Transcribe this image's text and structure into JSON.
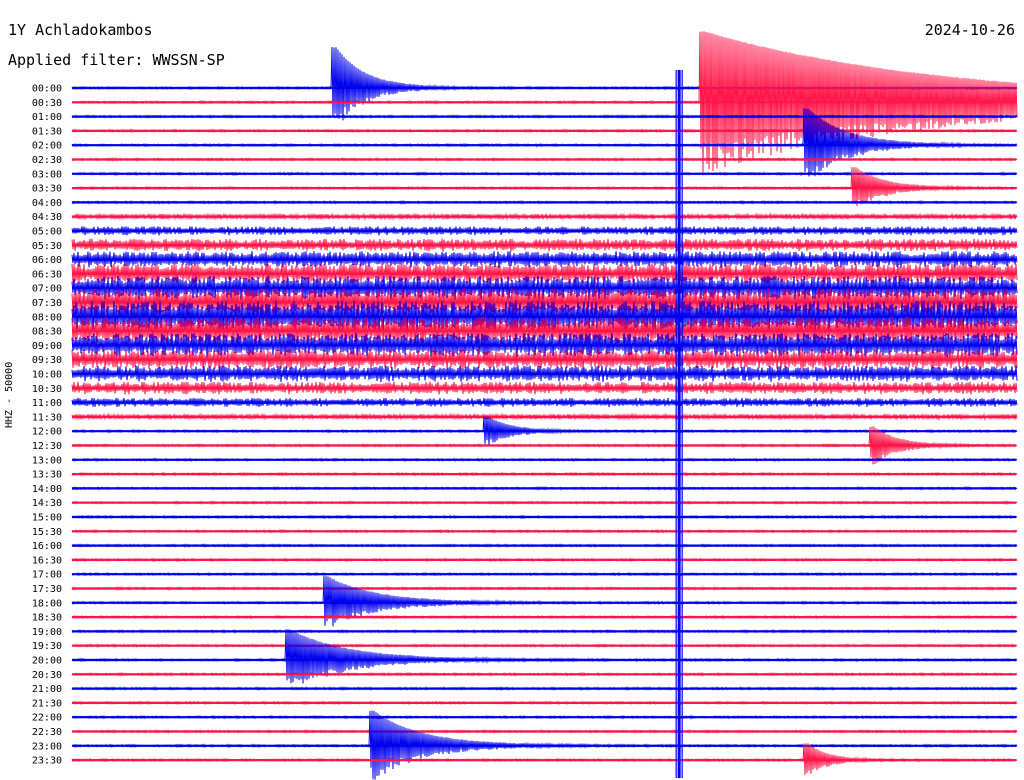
{
  "header": {
    "station": "1Y Achladokambos",
    "date": "2024-10-26",
    "filter": "Applied filter: WWSSN-SP"
  },
  "ylabel": "HHZ - 50000",
  "chart_data": {
    "type": "line",
    "title": "1Y Achladokambos",
    "subtitle": "Applied filter: WWSSN-SP",
    "ylabel": "HHZ - 50000",
    "date": "2024-10-26",
    "time_labels": [
      "00:00",
      "00:30",
      "01:00",
      "01:30",
      "02:00",
      "02:30",
      "03:00",
      "03:30",
      "04:00",
      "04:30",
      "05:00",
      "05:30",
      "06:00",
      "06:30",
      "07:00",
      "07:30",
      "08:00",
      "08:30",
      "09:00",
      "09:30",
      "10:00",
      "10:30",
      "11:00",
      "11:30",
      "12:00",
      "12:30",
      "13:00",
      "13:30",
      "14:00",
      "14:30",
      "15:00",
      "15:30",
      "16:00",
      "16:30",
      "17:00",
      "17:30",
      "18:00",
      "18:30",
      "19:00",
      "19:30",
      "20:00",
      "20:30",
      "21:00",
      "21:30",
      "22:00",
      "22:30",
      "23:00",
      "23:30"
    ],
    "trace_colors": [
      "#0000ee",
      "#ff1548"
    ],
    "events": [
      {
        "row": 0,
        "x": 0.28,
        "amp": 40,
        "decay": 0.03
      },
      {
        "row": 1,
        "x": 0.67,
        "amp": 70,
        "decay": 0.25
      },
      {
        "row": 4,
        "x": 0.78,
        "amp": 36,
        "decay": 0.04
      },
      {
        "row": 7,
        "x": 0.83,
        "amp": 20,
        "decay": 0.03
      },
      {
        "row": 24,
        "x": 0.44,
        "amp": 14,
        "decay": 0.025
      },
      {
        "row": 25,
        "x": 0.85,
        "amp": 18,
        "decay": 0.025
      },
      {
        "row": 36,
        "x": 0.27,
        "amp": 26,
        "decay": 0.05
      },
      {
        "row": 40,
        "x": 0.23,
        "amp": 30,
        "decay": 0.06
      },
      {
        "row": 46,
        "x": 0.32,
        "amp": 34,
        "decay": 0.05
      },
      {
        "row": 47,
        "x": 0.78,
        "amp": 16,
        "decay": 0.02
      }
    ],
    "noisy_rows": {
      "from": 9,
      "to": 23,
      "peak": 16
    },
    "spike_column": {
      "x": 0.64,
      "from_row": 0,
      "to_row": 47
    }
  }
}
